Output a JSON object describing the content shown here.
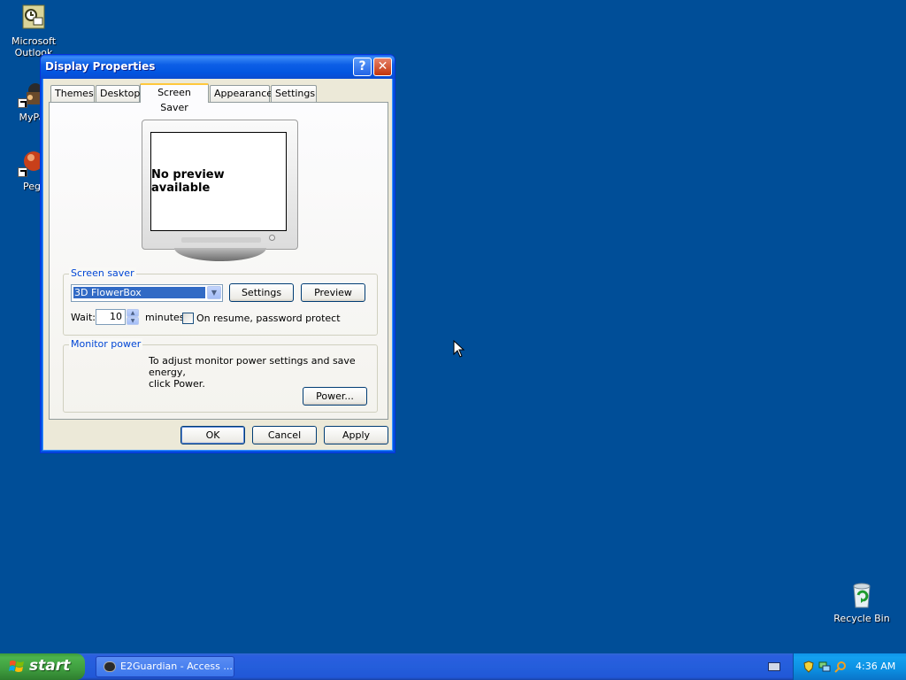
{
  "desktop": {
    "icons": [
      {
        "label": "Microsoft Outlook"
      },
      {
        "label": "MyPa"
      },
      {
        "label": "Peg"
      }
    ],
    "recycle_bin": {
      "label": "Recycle Bin"
    }
  },
  "window": {
    "title": "Display Properties",
    "help_glyph": "?",
    "close_glyph": "✕",
    "tabs": [
      {
        "label": "Themes",
        "active": false
      },
      {
        "label": "Desktop",
        "active": false
      },
      {
        "label": "Screen Saver",
        "active": true
      },
      {
        "label": "Appearance",
        "active": false
      },
      {
        "label": "Settings",
        "active": false
      }
    ],
    "preview_text": "No preview available",
    "screen_saver_group": {
      "label": "Screen saver",
      "selected": "3D FlowerBox",
      "settings_button": "Settings",
      "preview_button": "Preview",
      "wait_label": "Wait:",
      "wait_value": "10",
      "minutes_label": "minutes",
      "password_label": "On resume, password protect",
      "password_checked": false
    },
    "monitor_power_group": {
      "label": "Monitor power",
      "description_line1": "To adjust monitor power settings and save energy,",
      "description_line2": "click Power.",
      "power_button": "Power..."
    },
    "ok_button": "OK",
    "cancel_button": "Cancel",
    "apply_button": "Apply"
  },
  "taskbar": {
    "start_label": "start",
    "task_label": "E2Guardian - Access ...",
    "clock": "4:36 AM"
  },
  "colors": {
    "desktop_background": "#004e98",
    "title_bar": "#0255e0",
    "start_button": "#3f9d3f",
    "tray": "#0c8fe2",
    "group_label": "#0046d5"
  }
}
